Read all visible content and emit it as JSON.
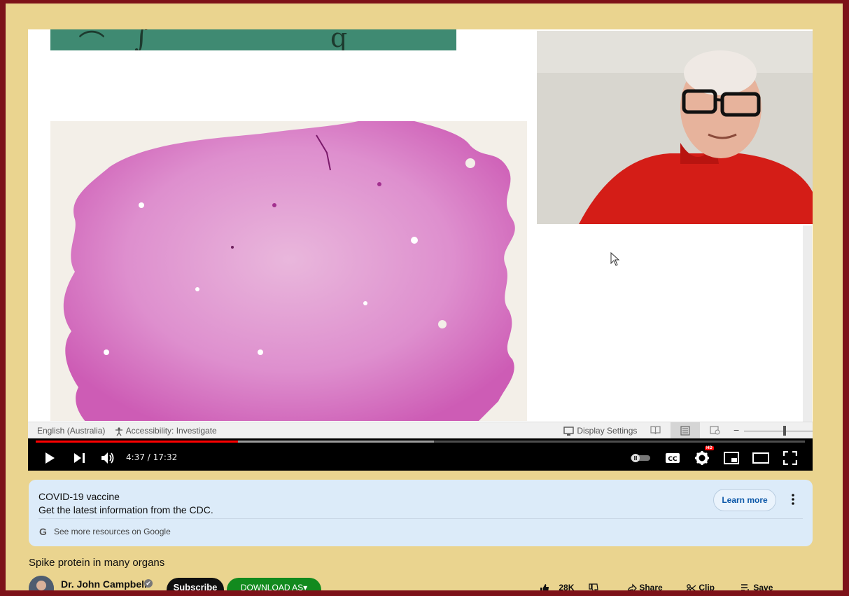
{
  "viewer_bar": {
    "language": "English (Australia)",
    "accessibility": "Accessibility: Investigate",
    "display_settings": "Display Settings"
  },
  "player": {
    "current_time": "4:37",
    "time_separator": " / ",
    "duration": "17:32",
    "played_fraction": 0.2634,
    "buffered_fraction": 0.5173,
    "hd_badge": "HD"
  },
  "info_panel": {
    "title": "COVID-19 vaccine",
    "subtitle": "Get the latest information from the CDC.",
    "google_glyph": "G",
    "resources_link": "See more resources on Google",
    "learn_more": "Learn more"
  },
  "video": {
    "title": "Spike protein in many organs",
    "channel": "Dr. John Campbell",
    "verified_glyph": "✔",
    "subscribe": "Subscribe",
    "download": "DOWNLOAD AS▾"
  },
  "actions": {
    "likes": "28K",
    "share": "Share",
    "clip": "Clip",
    "save": "Save"
  },
  "colors": {
    "frame": "#ead48f",
    "border": "#7d1219",
    "progress_played": "#ff0000",
    "info_panel": "#dcebf9"
  }
}
